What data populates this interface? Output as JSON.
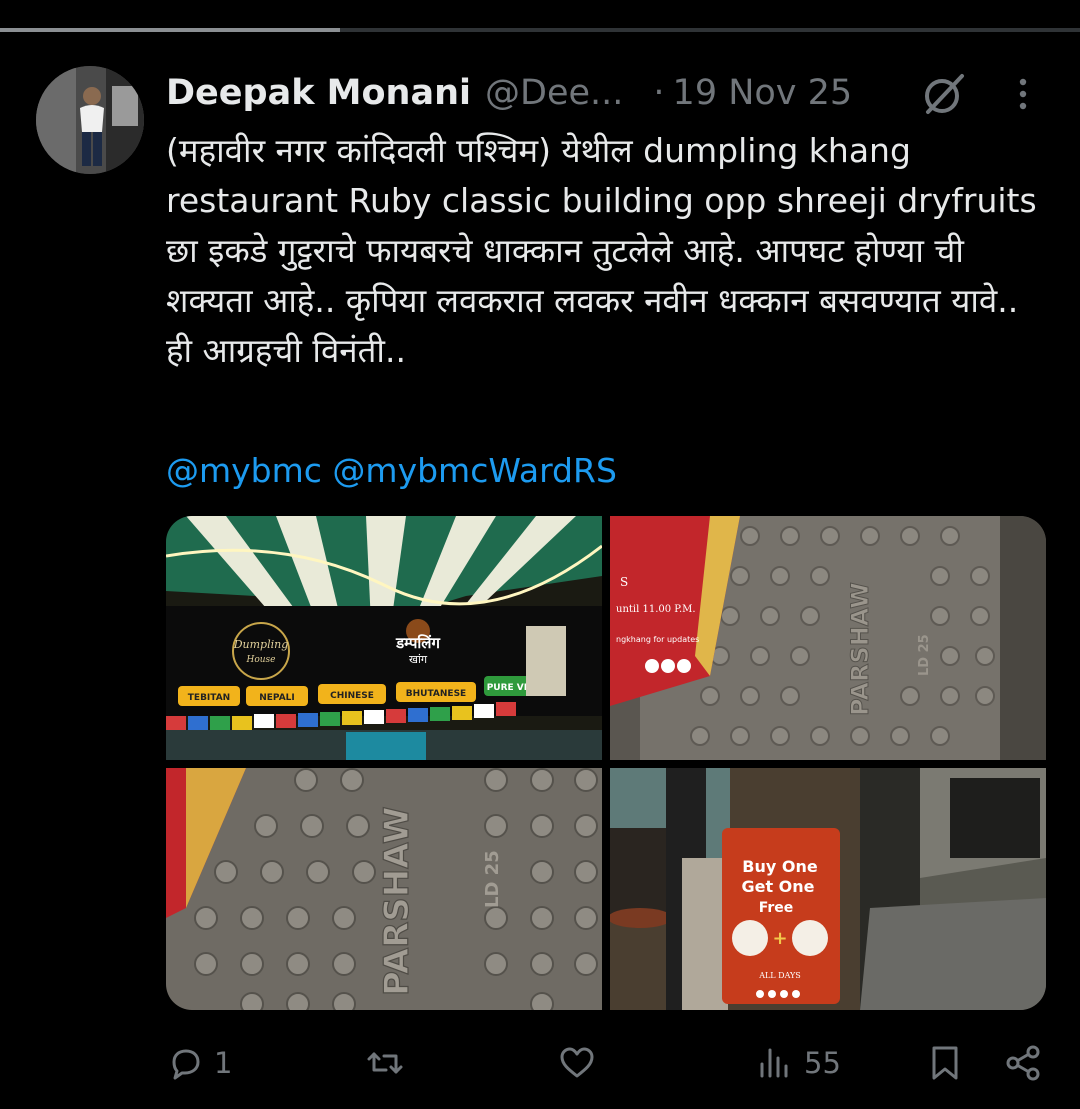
{
  "scroll": {
    "progress": 0.315
  },
  "tweet": {
    "author_name": "Deepak Monani",
    "author_handle": "@Dee...",
    "separator": "·",
    "date": "19 Nov 25",
    "text": "(महावीर नगर कांदिवली पश्चिम) येथील  dumpling khang restaurant Ruby classic building opp shreeji dryfruits\nछा इकडे गुट्टराचे फायबरचे धाक्कान तुटलेले आहे. आपघट होण्या ची शक्यता आहे.. कृपिया लवकरात लवकर नवीन धक्कान बसवण्यात यावे.. ही आग्रहची विनंती..",
    "mentions": [
      "@mybmc",
      "@mybmcWardRS"
    ]
  },
  "photos": {
    "sign": {
      "logo_left_line1": "Dumpling",
      "logo_left_line2": "House",
      "logo_right_line1": "डम्पलिंग",
      "logo_right_line2": "खांग",
      "cuisines": [
        "TEBITAN",
        "NEPALI",
        "CHINESE",
        "BHUTANESE",
        "PURE VEG"
      ]
    },
    "cover_top": {
      "brand": "PARSHAW",
      "mark": "LD 25",
      "flyer_text_1": "S",
      "flyer_text_2": "until 11.00 P.M.",
      "flyer_text_3": "ngkhang for updates"
    },
    "cover_close": {
      "brand": "PARSHAW",
      "mark": "LD 25"
    },
    "poster": {
      "line1": "Buy One",
      "line2": "Get One",
      "line3": "Free",
      "plus": "+",
      "footer": "ALL DAYS"
    }
  },
  "actions": {
    "replies": "1",
    "reposts": "",
    "likes": "",
    "views": "55"
  },
  "colors": {
    "background": "#000000",
    "text": "#e7e9ea",
    "muted": "#71767b",
    "link": "#1d9bf0"
  },
  "icons": [
    "grok-icon",
    "more-icon",
    "reply-icon",
    "repost-icon",
    "like-icon",
    "views-icon",
    "bookmark-icon",
    "share-icon"
  ]
}
